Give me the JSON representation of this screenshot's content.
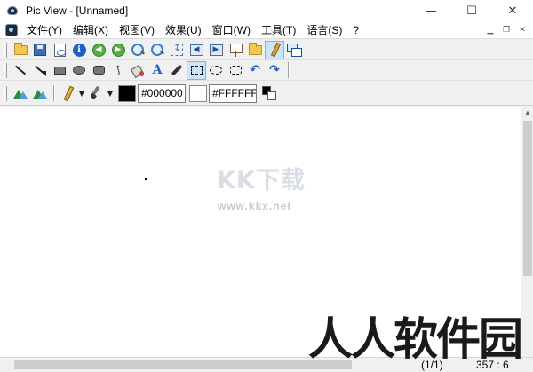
{
  "window": {
    "title": "Pic View - [Unnamed]",
    "controls": {
      "minimize": "—",
      "maximize": "☐",
      "close": "✕"
    }
  },
  "menubar": {
    "items": [
      {
        "label": "文件(Y)"
      },
      {
        "label": "编辑(X)"
      },
      {
        "label": "视图(V)"
      },
      {
        "label": "效果(U)"
      },
      {
        "label": "窗口(W)"
      },
      {
        "label": "工具(T)"
      },
      {
        "label": "语言(S)"
      },
      {
        "label": "?"
      }
    ],
    "mdi_controls": {
      "minimize": "▁",
      "restore": "❐",
      "close": "✕"
    }
  },
  "toolbar_main": {
    "icons": [
      "open-folder-icon",
      "save-disk-icon",
      "print-preview-icon",
      "info-icon",
      "previous-image-icon",
      "next-image-icon",
      "zoom-in-icon",
      "zoom-out-icon",
      "fit-height-icon",
      "rotate-left-icon",
      "rotate-right-icon",
      "slideshow-icon",
      "browse-folder-icon",
      "draw-pencil-icon",
      "cascade-windows-icon"
    ]
  },
  "toolbar_draw": {
    "icons": [
      "line-icon",
      "arrow-line-icon",
      "filled-rectangle-icon",
      "filled-ellipse-icon",
      "filled-rounded-rectangle-icon",
      "curve-icon",
      "fill-bucket-icon",
      "text-icon",
      "eyedropper-icon",
      "rectangle-select-icon",
      "ellipse-select-icon",
      "rounded-rectangle-select-icon",
      "undo-icon",
      "redo-icon"
    ],
    "glyphs": {
      "curve": "⟆",
      "text": "A",
      "undo": "↶",
      "redo": "↷"
    }
  },
  "toolbar_color": {
    "dropdown_caret": "▼",
    "foreground_hex": "#000000",
    "background_hex": "#FFFFFF",
    "foreground_color": "#000000",
    "background_color": "#ffffff"
  },
  "scrollbar": {
    "up": "▲",
    "down": "▼"
  },
  "statusbar": {
    "page": "(1/1)",
    "coords": "357 : 6"
  },
  "watermarks": {
    "center_text": "KK下载",
    "center_url": "www.kkx.net",
    "corner_text": "人人软件园"
  },
  "colors": {
    "selected_tool_bg": "#cce4f7",
    "selected_tool_border": "#7eb4ea",
    "chrome_bg": "#f0f0f0"
  }
}
